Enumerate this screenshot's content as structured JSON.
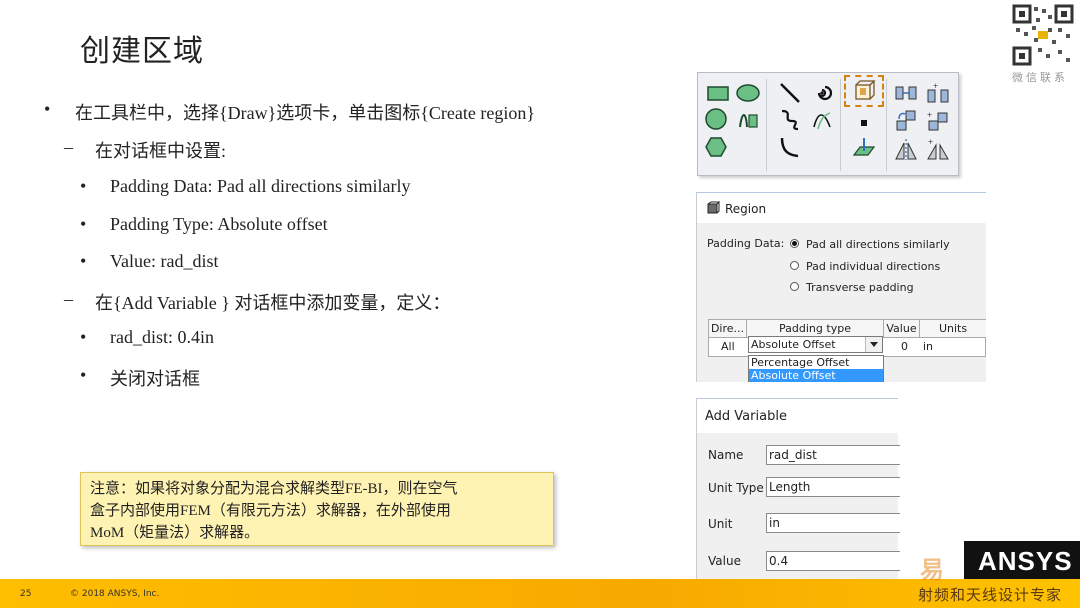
{
  "slide": {
    "title": "创建区域",
    "bullets": [
      {
        "marker": "•",
        "text": "在工具栏中，选择{Draw}选项卡，单击图标{Create region}"
      },
      {
        "marker": "–",
        "text": "在对话框中设置:"
      },
      {
        "marker": "•",
        "text": "Padding Data: Pad all directions similarly"
      },
      {
        "marker": "•",
        "text": "Padding Type: Absolute offset"
      },
      {
        "marker": "•",
        "text": "Value: rad_dist"
      },
      {
        "marker": "–",
        "text": "在{Add Variable } 对话框中添加变量，定义："
      },
      {
        "marker": "•",
        "text": "rad_dist: 0.4in"
      },
      {
        "marker": "•",
        "text": "关闭对话框"
      }
    ],
    "note": [
      "注意：如果将对象分配为混合求解类型FE-BI，则在空气",
      "盒子内部使用FEM（有限元方法）求解器，在外部使用",
      "MoM（矩量法）求解器。"
    ],
    "qr_caption": "微信联系"
  },
  "toolbar": {
    "icons": [
      "rectangle-icon",
      "ellipse-icon",
      "line-icon",
      "spiral-icon",
      "create-region-icon",
      "circle-icon",
      "equation-curve-icon",
      "spline-icon",
      "equation-surface-icon",
      "point-icon",
      "polygon-icon",
      "arc-icon",
      "plane-icon",
      "duplicate-along-line-icon",
      "duplicate-around-axis-icon",
      "mirror-icon",
      "duplicate-mirror-icon",
      "sweep-icon",
      "mirror-plane-icon"
    ]
  },
  "region": {
    "title": "Region",
    "padding_data_label": "Padding Data:",
    "options": [
      "Pad all directions similarly",
      "Pad individual directions",
      "Transverse padding"
    ],
    "selected_option": 0,
    "table": {
      "headers": [
        "Dire...",
        "Padding type",
        "Value",
        "Units"
      ],
      "row": {
        "direction": "All",
        "padding_type": "Absolute Offset",
        "value": "0",
        "units": "in"
      }
    },
    "dropdown": [
      "Percentage Offset",
      "Absolute Offset"
    ],
    "dropdown_highlighted": 1
  },
  "add_variable": {
    "title": "Add Variable",
    "fields": [
      {
        "label": "Name",
        "value": "rad_dist"
      },
      {
        "label": "Unit Type",
        "value": "Length"
      },
      {
        "label": "Unit",
        "value": "in"
      },
      {
        "label": "Value",
        "value": "0.4"
      }
    ]
  },
  "footer": {
    "page_number": "25",
    "copyright": "© 2018 ANSYS, Inc.",
    "logo_text": "ANSYS",
    "watermark": "易",
    "watermark_caption": "射频和天线设计专家"
  },
  "colors": {
    "footer_gold": "#f7a900",
    "note_bg": "#fff3b3",
    "highlight_blue": "#3399ff",
    "selection_orange": "#d4820e"
  }
}
